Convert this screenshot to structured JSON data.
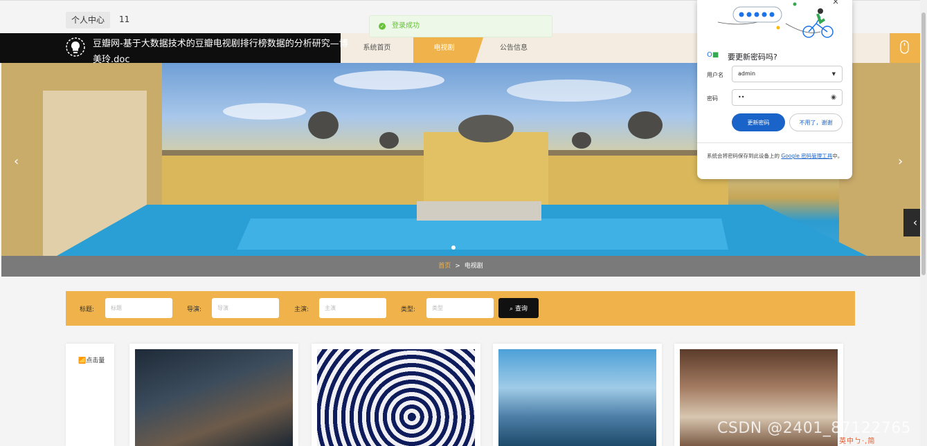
{
  "userbar": {
    "center_label": "个人中心",
    "username": "11"
  },
  "toast": {
    "message": "登录成功"
  },
  "header": {
    "title_line1": "豆瓣网-基于大数据技术的豆瓣电视剧排行榜数据的分析研究—博",
    "title_line2": "美玲.doc",
    "nav": [
      {
        "label": "系统首页"
      },
      {
        "label": "电视剧"
      },
      {
        "label": "公告信息"
      }
    ]
  },
  "banner": {
    "prev": "‹",
    "next": "›"
  },
  "side": {
    "collapse": "‹"
  },
  "breadcrumb": {
    "home": "首页",
    "sep": ">",
    "current": "电视剧"
  },
  "search": {
    "title_label": "标题:",
    "title_placeholder": "标题",
    "director_label": "导演:",
    "director_placeholder": "导演",
    "actor_label": "主演:",
    "actor_placeholder": "主演",
    "type_label": "类型:",
    "type_placeholder": "类型",
    "button": "查询"
  },
  "sort": {
    "clicks": "点击量"
  },
  "password_popup": {
    "title": "要更新密码吗?",
    "username_label": "用户名",
    "username_value": "admin",
    "password_label": "密码",
    "password_value": "••",
    "update_button": "更新密码",
    "no_button": "不用了，谢谢",
    "footer_text": "系统会将密码保存到此设备上的",
    "footer_link": "Google 密码管理工具",
    "footer_end": "中。"
  },
  "watermark": "CSDN @2401_87122765",
  "ime": "英中ㄅ·,简"
}
